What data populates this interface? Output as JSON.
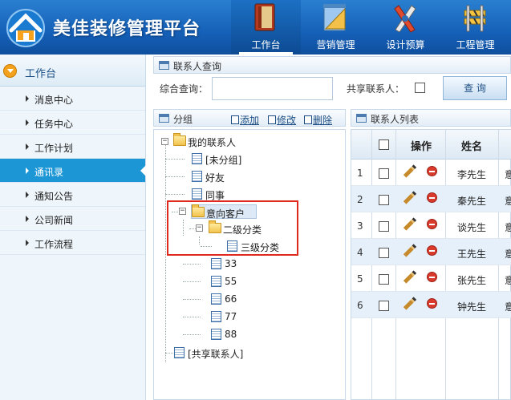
{
  "app": {
    "title": "美佳装修管理平台"
  },
  "topnav": [
    {
      "label": "工作台",
      "icon": "book-icon"
    },
    {
      "label": "营销管理",
      "icon": "ruler-pad-icon"
    },
    {
      "label": "设计预算",
      "icon": "design-tools-icon"
    },
    {
      "label": "工程管理",
      "icon": "construction-barrier-icon"
    }
  ],
  "sidebar": {
    "title": "工作台",
    "items": [
      "消息中心",
      "任务中心",
      "工作计划",
      "通讯录",
      "通知公告",
      "公司新闻",
      "工作流程"
    ]
  },
  "query": {
    "section_title": "联系人查询",
    "search_label": "综合查询：",
    "search_value": "",
    "share_label": "共享联系人：",
    "button": "查 询"
  },
  "group": {
    "title": "分组",
    "add": "添加",
    "edit": "修改",
    "del": "删除",
    "tree": {
      "root": "我的联系人",
      "items": [
        "[未分组]",
        "好友",
        "同事"
      ],
      "selected": "意向客户",
      "sub": "二级分类",
      "subsub": "三级分类",
      "more": [
        "33",
        "55",
        "66",
        "77",
        "88"
      ],
      "shared": "[共享联系人]"
    }
  },
  "contacts": {
    "title": "联系人列表",
    "col_op": "操作",
    "col_name": "姓名",
    "rows": [
      {
        "n": "1",
        "name": "李先生",
        "cut": "意"
      },
      {
        "n": "2",
        "name": "秦先生",
        "cut": "意"
      },
      {
        "n": "3",
        "name": "谈先生",
        "cut": "意"
      },
      {
        "n": "4",
        "name": "王先生",
        "cut": "意"
      },
      {
        "n": "5",
        "name": "张先生",
        "cut": "意"
      },
      {
        "n": "6",
        "name": "钟先生",
        "cut": "意"
      }
    ]
  },
  "colors": {
    "header": "#1560b8",
    "active_side": "#1d96d6",
    "highlight": "#e0291c"
  }
}
